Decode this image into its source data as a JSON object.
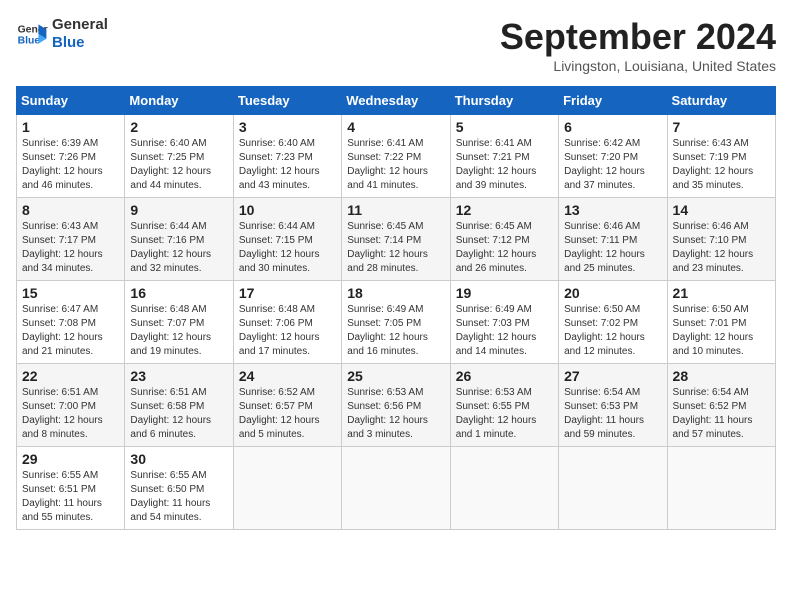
{
  "header": {
    "logo_line1": "General",
    "logo_line2": "Blue",
    "month_title": "September 2024",
    "location": "Livingston, Louisiana, United States"
  },
  "weekdays": [
    "Sunday",
    "Monday",
    "Tuesday",
    "Wednesday",
    "Thursday",
    "Friday",
    "Saturday"
  ],
  "weeks": [
    [
      {
        "day": "1",
        "text": "Sunrise: 6:39 AM\nSunset: 7:26 PM\nDaylight: 12 hours\nand 46 minutes."
      },
      {
        "day": "2",
        "text": "Sunrise: 6:40 AM\nSunset: 7:25 PM\nDaylight: 12 hours\nand 44 minutes."
      },
      {
        "day": "3",
        "text": "Sunrise: 6:40 AM\nSunset: 7:23 PM\nDaylight: 12 hours\nand 43 minutes."
      },
      {
        "day": "4",
        "text": "Sunrise: 6:41 AM\nSunset: 7:22 PM\nDaylight: 12 hours\nand 41 minutes."
      },
      {
        "day": "5",
        "text": "Sunrise: 6:41 AM\nSunset: 7:21 PM\nDaylight: 12 hours\nand 39 minutes."
      },
      {
        "day": "6",
        "text": "Sunrise: 6:42 AM\nSunset: 7:20 PM\nDaylight: 12 hours\nand 37 minutes."
      },
      {
        "day": "7",
        "text": "Sunrise: 6:43 AM\nSunset: 7:19 PM\nDaylight: 12 hours\nand 35 minutes."
      }
    ],
    [
      {
        "day": "8",
        "text": "Sunrise: 6:43 AM\nSunset: 7:17 PM\nDaylight: 12 hours\nand 34 minutes."
      },
      {
        "day": "9",
        "text": "Sunrise: 6:44 AM\nSunset: 7:16 PM\nDaylight: 12 hours\nand 32 minutes."
      },
      {
        "day": "10",
        "text": "Sunrise: 6:44 AM\nSunset: 7:15 PM\nDaylight: 12 hours\nand 30 minutes."
      },
      {
        "day": "11",
        "text": "Sunrise: 6:45 AM\nSunset: 7:14 PM\nDaylight: 12 hours\nand 28 minutes."
      },
      {
        "day": "12",
        "text": "Sunrise: 6:45 AM\nSunset: 7:12 PM\nDaylight: 12 hours\nand 26 minutes."
      },
      {
        "day": "13",
        "text": "Sunrise: 6:46 AM\nSunset: 7:11 PM\nDaylight: 12 hours\nand 25 minutes."
      },
      {
        "day": "14",
        "text": "Sunrise: 6:46 AM\nSunset: 7:10 PM\nDaylight: 12 hours\nand 23 minutes."
      }
    ],
    [
      {
        "day": "15",
        "text": "Sunrise: 6:47 AM\nSunset: 7:08 PM\nDaylight: 12 hours\nand 21 minutes."
      },
      {
        "day": "16",
        "text": "Sunrise: 6:48 AM\nSunset: 7:07 PM\nDaylight: 12 hours\nand 19 minutes."
      },
      {
        "day": "17",
        "text": "Sunrise: 6:48 AM\nSunset: 7:06 PM\nDaylight: 12 hours\nand 17 minutes."
      },
      {
        "day": "18",
        "text": "Sunrise: 6:49 AM\nSunset: 7:05 PM\nDaylight: 12 hours\nand 16 minutes."
      },
      {
        "day": "19",
        "text": "Sunrise: 6:49 AM\nSunset: 7:03 PM\nDaylight: 12 hours\nand 14 minutes."
      },
      {
        "day": "20",
        "text": "Sunrise: 6:50 AM\nSunset: 7:02 PM\nDaylight: 12 hours\nand 12 minutes."
      },
      {
        "day": "21",
        "text": "Sunrise: 6:50 AM\nSunset: 7:01 PM\nDaylight: 12 hours\nand 10 minutes."
      }
    ],
    [
      {
        "day": "22",
        "text": "Sunrise: 6:51 AM\nSunset: 7:00 PM\nDaylight: 12 hours\nand 8 minutes."
      },
      {
        "day": "23",
        "text": "Sunrise: 6:51 AM\nSunset: 6:58 PM\nDaylight: 12 hours\nand 6 minutes."
      },
      {
        "day": "24",
        "text": "Sunrise: 6:52 AM\nSunset: 6:57 PM\nDaylight: 12 hours\nand 5 minutes."
      },
      {
        "day": "25",
        "text": "Sunrise: 6:53 AM\nSunset: 6:56 PM\nDaylight: 12 hours\nand 3 minutes."
      },
      {
        "day": "26",
        "text": "Sunrise: 6:53 AM\nSunset: 6:55 PM\nDaylight: 12 hours\nand 1 minute."
      },
      {
        "day": "27",
        "text": "Sunrise: 6:54 AM\nSunset: 6:53 PM\nDaylight: 11 hours\nand 59 minutes."
      },
      {
        "day": "28",
        "text": "Sunrise: 6:54 AM\nSunset: 6:52 PM\nDaylight: 11 hours\nand 57 minutes."
      }
    ],
    [
      {
        "day": "29",
        "text": "Sunrise: 6:55 AM\nSunset: 6:51 PM\nDaylight: 11 hours\nand 55 minutes."
      },
      {
        "day": "30",
        "text": "Sunrise: 6:55 AM\nSunset: 6:50 PM\nDaylight: 11 hours\nand 54 minutes."
      },
      {
        "day": "",
        "text": ""
      },
      {
        "day": "",
        "text": ""
      },
      {
        "day": "",
        "text": ""
      },
      {
        "day": "",
        "text": ""
      },
      {
        "day": "",
        "text": ""
      }
    ]
  ]
}
